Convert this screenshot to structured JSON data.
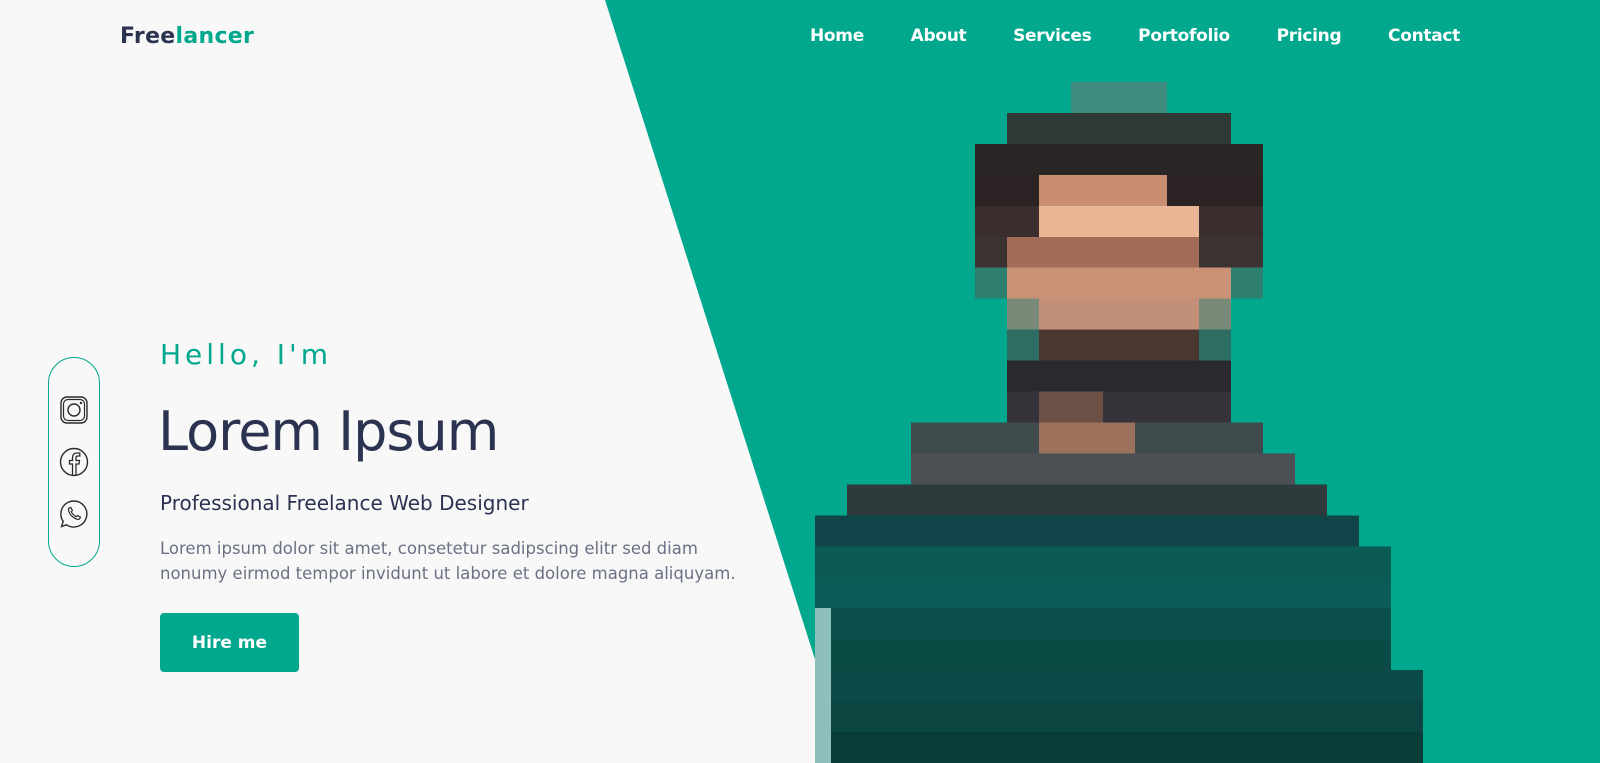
{
  "brand": {
    "part1": "Free",
    "part2": "lancer"
  },
  "nav": {
    "items": [
      {
        "label": "Home"
      },
      {
        "label": "About"
      },
      {
        "label": "Services"
      },
      {
        "label": "Portofolio"
      },
      {
        "label": "Pricing"
      },
      {
        "label": "Contact"
      }
    ]
  },
  "hero": {
    "greeting": "Hello, I'm",
    "name": "Lorem Ipsum",
    "role": "Professional Freelance Web Designer",
    "description": "Lorem ipsum dolor sit amet, consetetur sadipscing elitr sed diam nonumy eirmod tempor invidunt ut labore et dolore magna aliquyam.",
    "cta_label": "Hire me"
  },
  "social": {
    "icons": [
      "instagram-icon",
      "facebook-icon",
      "whatsapp-icon"
    ]
  },
  "colors": {
    "accent": "#02a88d",
    "dark_text": "#2b3350",
    "muted_text": "#6b7184",
    "background": "#f8f8f8"
  }
}
